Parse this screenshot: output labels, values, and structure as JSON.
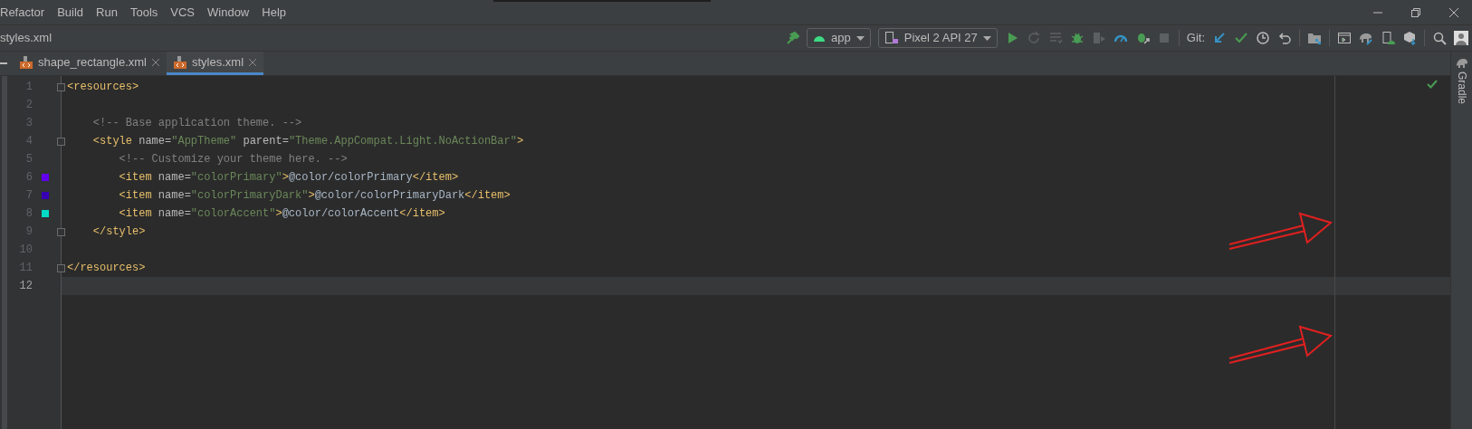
{
  "menu": [
    "Refactor",
    "Build",
    "Run",
    "Tools",
    "VCS",
    "Window",
    "Help"
  ],
  "breadcrumb": "styles.xml",
  "toolbar": {
    "config": "app",
    "device": "Pixel 2 API 27",
    "git_label": "Git:",
    "icons": [
      {
        "kind": "run",
        "disabled": false
      },
      {
        "kind": "rerun",
        "disabled": true
      },
      {
        "kind": "apply",
        "disabled": true
      },
      {
        "kind": "debug",
        "disabled": false
      },
      {
        "kind": "profile",
        "disabled": true
      },
      {
        "kind": "profiler",
        "disabled": false
      },
      {
        "kind": "attach",
        "disabled": false
      },
      {
        "kind": "stop",
        "disabled": true
      }
    ],
    "git_icons": [
      {
        "kind": "update"
      },
      {
        "kind": "commit"
      },
      {
        "kind": "history"
      },
      {
        "kind": "rollback"
      }
    ],
    "tail_icons": [
      {
        "kind": "structure"
      },
      {
        "kind": "layout"
      },
      {
        "kind": "sync"
      },
      {
        "kind": "avd"
      },
      {
        "kind": "sdk"
      },
      {
        "kind": "search"
      },
      {
        "kind": "user"
      }
    ]
  },
  "tabs": [
    {
      "label": "shape_rectangle.xml",
      "selected": false
    },
    {
      "label": "styles.xml",
      "selected": true
    }
  ],
  "side_panel": "Gradle",
  "lines": [
    {
      "number": "1",
      "fold": true,
      "current": false,
      "tokens": [
        {
          "kind": "tag",
          "text": "<resources>"
        }
      ]
    },
    {
      "number": "2",
      "fold": false,
      "current": false
    },
    {
      "number": "3",
      "fold": false,
      "current": false,
      "tokens": [
        {
          "kind": "comment",
          "text": "    <!-- Base application theme. -->"
        }
      ]
    },
    {
      "number": "4",
      "fold": true,
      "current": false,
      "tokens": [
        {
          "kind": "tag",
          "text": "    <style "
        },
        {
          "kind": "attr",
          "text": "name="
        },
        {
          "kind": "value",
          "text": "\"AppTheme\" "
        },
        {
          "kind": "attr",
          "text": "parent="
        },
        {
          "kind": "value",
          "text": "\"Theme.AppCompat.Light.NoActionBar\""
        },
        {
          "kind": "tag",
          "text": ">"
        }
      ]
    },
    {
      "number": "5",
      "fold": false,
      "current": false,
      "tokens": [
        {
          "kind": "comment",
          "text": "        <!-- Customize your theme here. -->"
        }
      ]
    },
    {
      "number": "6",
      "fold": false,
      "current": false,
      "color": "#6200ee",
      "tokens": [
        {
          "kind": "tag",
          "text": "        <item "
        },
        {
          "kind": "attr",
          "text": "name="
        },
        {
          "kind": "value",
          "text": "\"colorPrimary\""
        },
        {
          "kind": "tag",
          "text": ">"
        },
        {
          "kind": "text",
          "text": "@color/colorPrimary"
        },
        {
          "kind": "tag",
          "text": "</item>"
        }
      ]
    },
    {
      "number": "7",
      "fold": false,
      "current": false,
      "color": "#3700b3",
      "tokens": [
        {
          "kind": "tag",
          "text": "        <item "
        },
        {
          "kind": "attr",
          "text": "name="
        },
        {
          "kind": "value",
          "text": "\"colorPrimaryDark\""
        },
        {
          "kind": "tag",
          "text": ">"
        },
        {
          "kind": "text",
          "text": "@color/colorPrimaryDark"
        },
        {
          "kind": "tag",
          "text": "</item>"
        }
      ]
    },
    {
      "number": "8",
      "fold": false,
      "current": false,
      "color": "#03dac5",
      "tokens": [
        {
          "kind": "tag",
          "text": "        <item "
        },
        {
          "kind": "attr",
          "text": "name="
        },
        {
          "kind": "value",
          "text": "\"colorAccent\""
        },
        {
          "kind": "tag",
          "text": ">"
        },
        {
          "kind": "text",
          "text": "@color/colorAccent"
        },
        {
          "kind": "tag",
          "text": "</item>"
        }
      ]
    },
    {
      "number": "9",
      "fold": true,
      "current": false,
      "tokens": [
        {
          "kind": "tag",
          "text": "    </style>"
        }
      ]
    },
    {
      "number": "10",
      "fold": false,
      "current": false
    },
    {
      "number": "11",
      "fold": true,
      "current": false,
      "tokens": [
        {
          "kind": "tag",
          "text": "</resources>"
        }
      ]
    },
    {
      "number": "12",
      "fold": false,
      "current": true
    }
  ],
  "annotations": [
    {
      "kind": "arrow"
    },
    {
      "kind": "arrow"
    }
  ]
}
